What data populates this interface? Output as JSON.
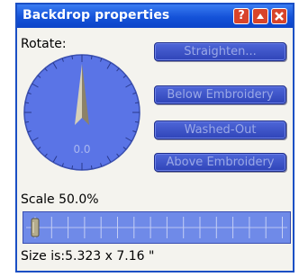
{
  "window": {
    "title": "Backdrop properties"
  },
  "title_buttons": {
    "help": "?",
    "minimize": "▲",
    "close": "✕"
  },
  "rotate": {
    "label": "Rotate:",
    "value": "0.0",
    "degrees": 0
  },
  "buttons": {
    "straighten": "Straighten...",
    "below_embroidery": "Below Embroidery",
    "washed_out": "Washed-Out",
    "above_embroidery": "Above Embroidery"
  },
  "scale": {
    "label": "Scale 50.0%",
    "slider_fraction": 0.0
  },
  "size": {
    "label": "Size is:5.323 x 7.16 \""
  },
  "colors": {
    "title_bar": "#1452d8",
    "dial_face": "#5a74e6",
    "button_face": "#3d55c8"
  }
}
